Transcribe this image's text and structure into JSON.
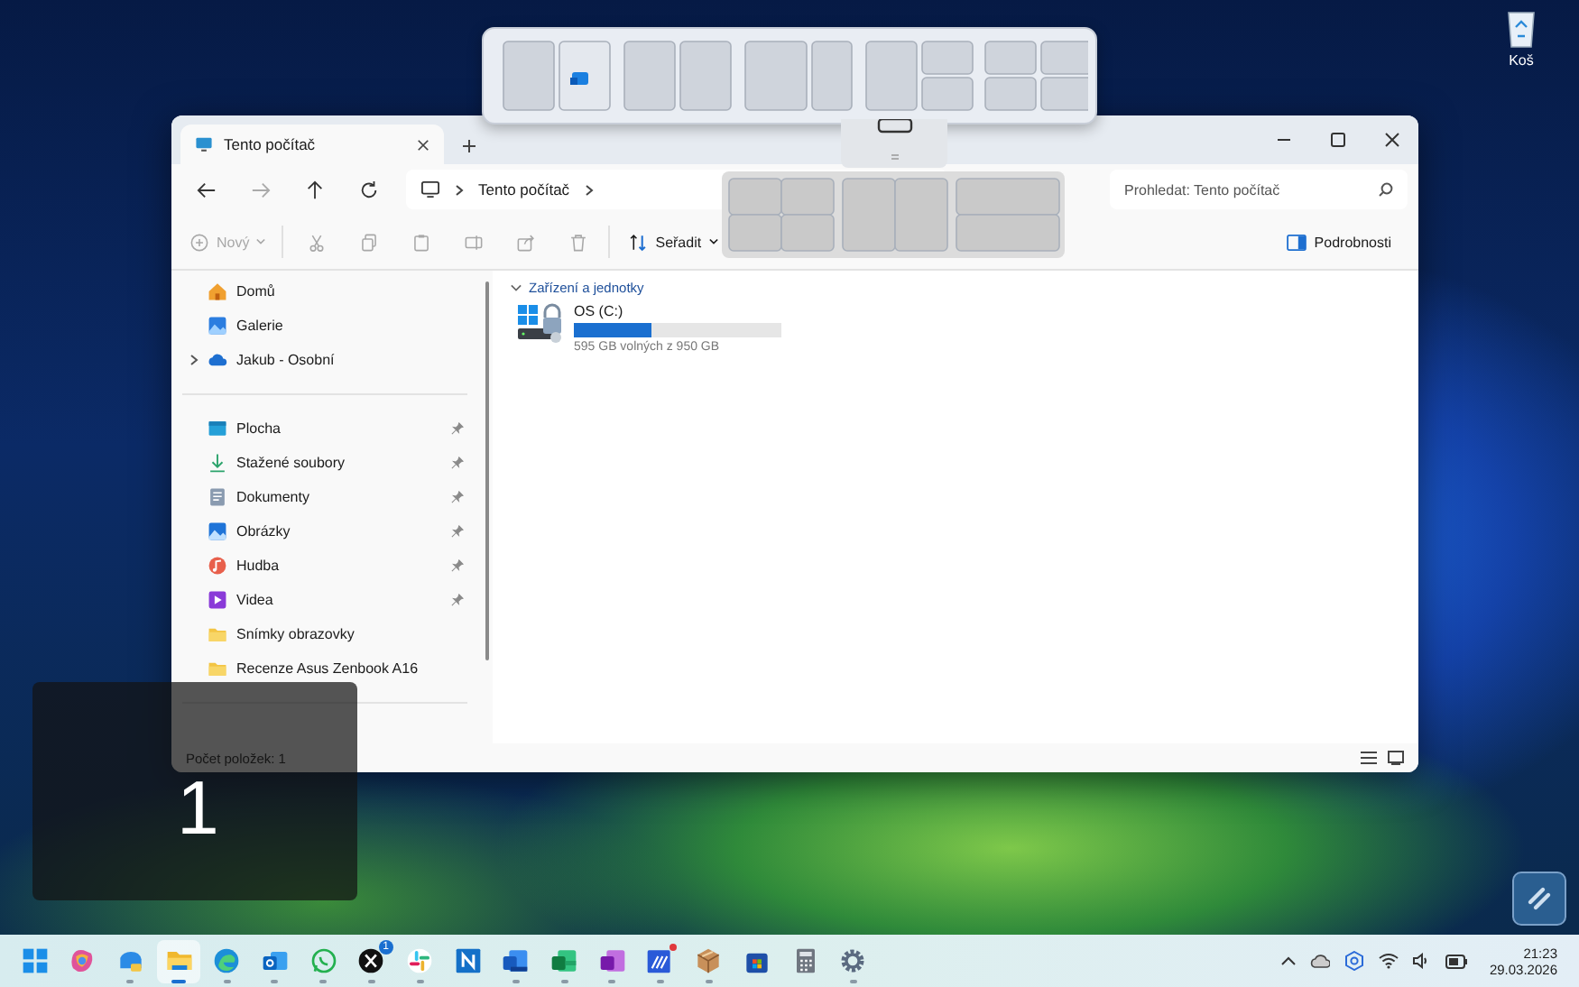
{
  "desktop": {
    "recycle_bin": {
      "label": "Koš"
    }
  },
  "snap_overlay": {
    "number": "1"
  },
  "explorer": {
    "tab": {
      "title": "Tento počítač",
      "selected": true
    },
    "address": {
      "crumbs": [
        "Tento počítač"
      ]
    },
    "search": {
      "placeholder": "Prohledat: Tento počítač"
    },
    "toolbar": [
      {
        "kind": "new",
        "label": "Nový",
        "disabled": true
      },
      {
        "kind": "cut",
        "disabled": true
      },
      {
        "kind": "copy",
        "disabled": true
      },
      {
        "kind": "paste",
        "disabled": true
      },
      {
        "kind": "rename",
        "disabled": true
      },
      {
        "kind": "share",
        "disabled": true
      },
      {
        "kind": "delete",
        "disabled": true
      },
      {
        "kind": "sort",
        "label": "Seřadit",
        "disabled": false
      }
    ],
    "details_button": {
      "label": "Podrobnosti"
    },
    "sidebar": {
      "groups": [
        [
          {
            "label": "Domů",
            "kind": "home",
            "pinned": false,
            "expandable": false,
            "selected": false
          },
          {
            "label": "Galerie",
            "kind": "gallery",
            "pinned": false,
            "expandable": false,
            "selected": false
          },
          {
            "label": "Jakub - Osobní",
            "kind": "cloud",
            "pinned": false,
            "expandable": true,
            "selected": false
          }
        ],
        [
          {
            "label": "Plocha",
            "kind": "desktop",
            "pinned": true,
            "expandable": false,
            "selected": false
          },
          {
            "label": "Stažené soubory",
            "kind": "download",
            "pinned": true,
            "expandable": false,
            "selected": false
          },
          {
            "label": "Dokumenty",
            "kind": "documents",
            "pinned": true,
            "expandable": false,
            "selected": false
          },
          {
            "label": "Obrázky",
            "kind": "pictures",
            "pinned": true,
            "expandable": false,
            "selected": false
          },
          {
            "label": "Hudba",
            "kind": "music",
            "pinned": true,
            "expandable": false,
            "selected": false
          },
          {
            "label": "Videa",
            "kind": "videos",
            "pinned": true,
            "expandable": false,
            "selected": false
          },
          {
            "label": "Snímky obrazovky",
            "kind": "folder",
            "pinned": false,
            "expandable": false,
            "selected": false
          },
          {
            "label": "Recenze Asus Zenbook A16",
            "kind": "folder",
            "pinned": false,
            "expandable": false,
            "selected": false
          }
        ]
      ]
    },
    "section": {
      "title": "Zařízení a jednotky",
      "expanded": true
    },
    "drives": [
      {
        "name": "OS (C:)",
        "level": 0.37,
        "free_text": "595 GB volných z 950 GB"
      }
    ],
    "status_bar": {
      "text": "Počet položek: 1"
    }
  },
  "taskbar": {
    "apps": [
      {
        "kind": "start",
        "selected": false,
        "running": false,
        "notification_dot": false
      },
      {
        "kind": "copilot",
        "selected": false,
        "running": false,
        "notification_dot": false
      },
      {
        "kind": "photos",
        "selected": false,
        "running": true,
        "notification_dot": false
      },
      {
        "kind": "explorer",
        "selected": true,
        "running": true,
        "notification_dot": false
      },
      {
        "kind": "edge",
        "selected": false,
        "running": true,
        "notification_dot": false
      },
      {
        "kind": "outlook",
        "selected": false,
        "running": true,
        "notification_dot": false
      },
      {
        "kind": "whatsapp",
        "selected": false,
        "running": true,
        "notification_dot": false
      },
      {
        "kind": "x",
        "selected": false,
        "running": true,
        "notification_dot": false,
        "badge": "1"
      },
      {
        "kind": "slack",
        "selected": false,
        "running": true,
        "notification_dot": false
      },
      {
        "kind": "notes",
        "selected": false,
        "running": false,
        "notification_dot": false
      },
      {
        "kind": "word",
        "selected": false,
        "running": true,
        "notification_dot": false
      },
      {
        "kind": "excel",
        "selected": false,
        "running": true,
        "notification_dot": false
      },
      {
        "kind": "onenote",
        "selected": false,
        "running": true,
        "notification_dot": false
      },
      {
        "kind": "stripes",
        "selected": false,
        "running": true,
        "notification_dot": true
      },
      {
        "kind": "craft",
        "selected": false,
        "running": true,
        "notification_dot": false
      },
      {
        "kind": "store",
        "selected": false,
        "running": false,
        "notification_dot": false
      },
      {
        "kind": "calculator",
        "selected": false,
        "running": false,
        "notification_dot": false
      },
      {
        "kind": "settings",
        "selected": false,
        "running": true,
        "notification_dot": false
      }
    ],
    "tray": {
      "time": "21:23",
      "date": "29.03.2026"
    }
  }
}
